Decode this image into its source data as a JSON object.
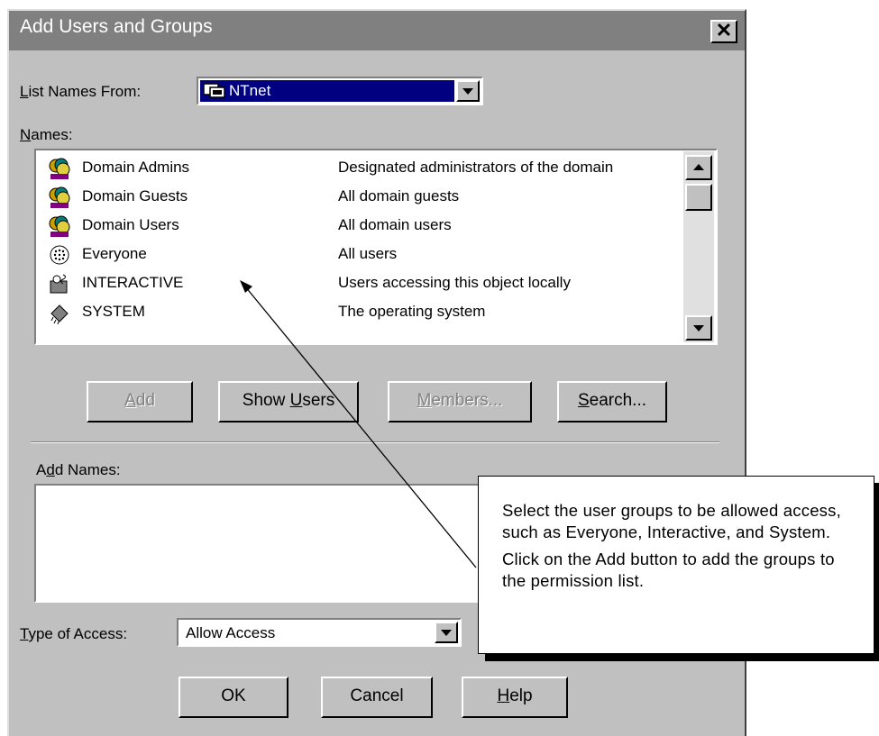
{
  "window": {
    "title": "Add Users and Groups",
    "close_glyph": "✕"
  },
  "list_names_from": {
    "label_u": "L",
    "label_rest": "ist Names From:",
    "value": "NTnet",
    "icon": "network-computer-icon"
  },
  "names": {
    "label_u": "N",
    "label_rest": "ames:",
    "rows": [
      {
        "name": "Domain Admins",
        "desc": "Designated administrators of the domain",
        "icon": "group-icon"
      },
      {
        "name": "Domain Guests",
        "desc": "All domain guests",
        "icon": "group-icon"
      },
      {
        "name": "Domain Users",
        "desc": "All domain users",
        "icon": "group-icon"
      },
      {
        "name": "Everyone",
        "desc": "All users",
        "icon": "globe-icon"
      },
      {
        "name": "INTERACTIVE",
        "desc": "Users accessing this object locally",
        "icon": "interactive-user-icon"
      },
      {
        "name": "SYSTEM",
        "desc": "The operating system",
        "icon": "chip-icon"
      }
    ]
  },
  "buttons": {
    "add": {
      "u": "A",
      "rest": "dd"
    },
    "show_users": {
      "pre": "Show ",
      "u": "U",
      "rest": "sers"
    },
    "members": {
      "u": "M",
      "rest": "embers..."
    },
    "search": {
      "u": "S",
      "rest": "earch..."
    },
    "ok": "OK",
    "cancel": "Cancel",
    "help": {
      "u": "H",
      "rest": "elp"
    }
  },
  "add_names": {
    "pre": "A",
    "u": "d",
    "rest": "d Names:",
    "value": ""
  },
  "type_of_access": {
    "label_u": "T",
    "label_rest": "ype of Access:",
    "value": "Allow Access"
  },
  "callout": {
    "para1": "Select the user groups to be allowed access, such as Everyone, Interactive, and System.",
    "para2": "Click on the Add button to add the groups to the permission list."
  },
  "colors": {
    "dialog_bg": "#c0c0c0",
    "titlebar": "#808080",
    "selection": "#000080"
  }
}
